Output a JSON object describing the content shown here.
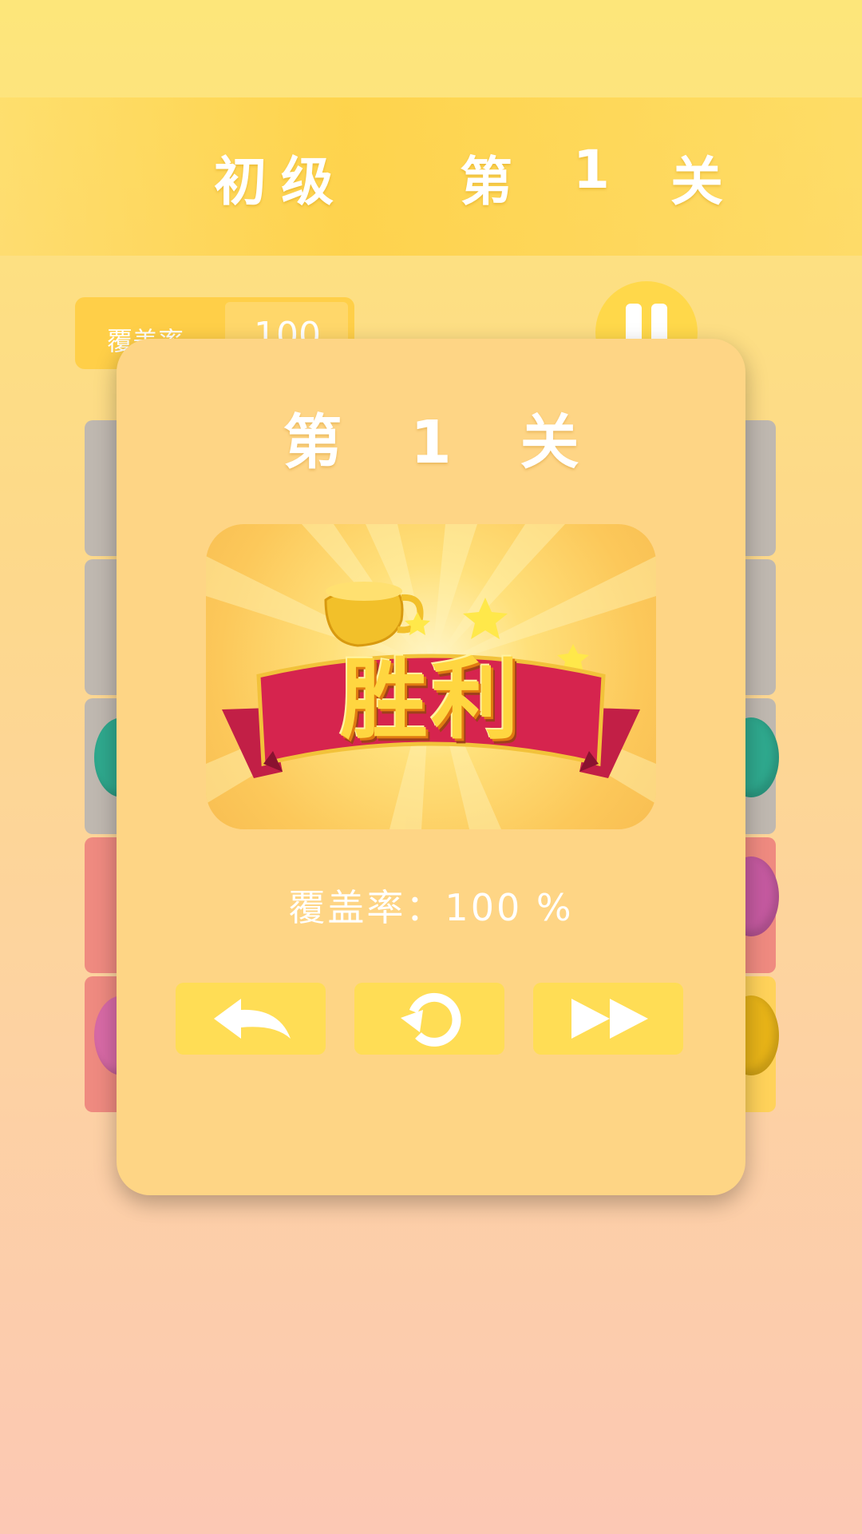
{
  "header": {
    "difficulty": "初级",
    "level_prefix": "第",
    "level_number": "1",
    "level_suffix": "关"
  },
  "stats": {
    "coverage_label": "覆盖率",
    "coverage_value": "100"
  },
  "dialog": {
    "title": "第 1 关",
    "victory_text": "胜利",
    "coverage_text": "覆盖率：100 %"
  },
  "buttons": {
    "back_icon": "back-arrow-icon",
    "retry_icon": "retry-icon",
    "next_icon": "fast-forward-icon"
  },
  "colors": {
    "dialog_bg": "#fed585",
    "button_bg": "#ffdd55",
    "header_band": "#ffce3c"
  }
}
